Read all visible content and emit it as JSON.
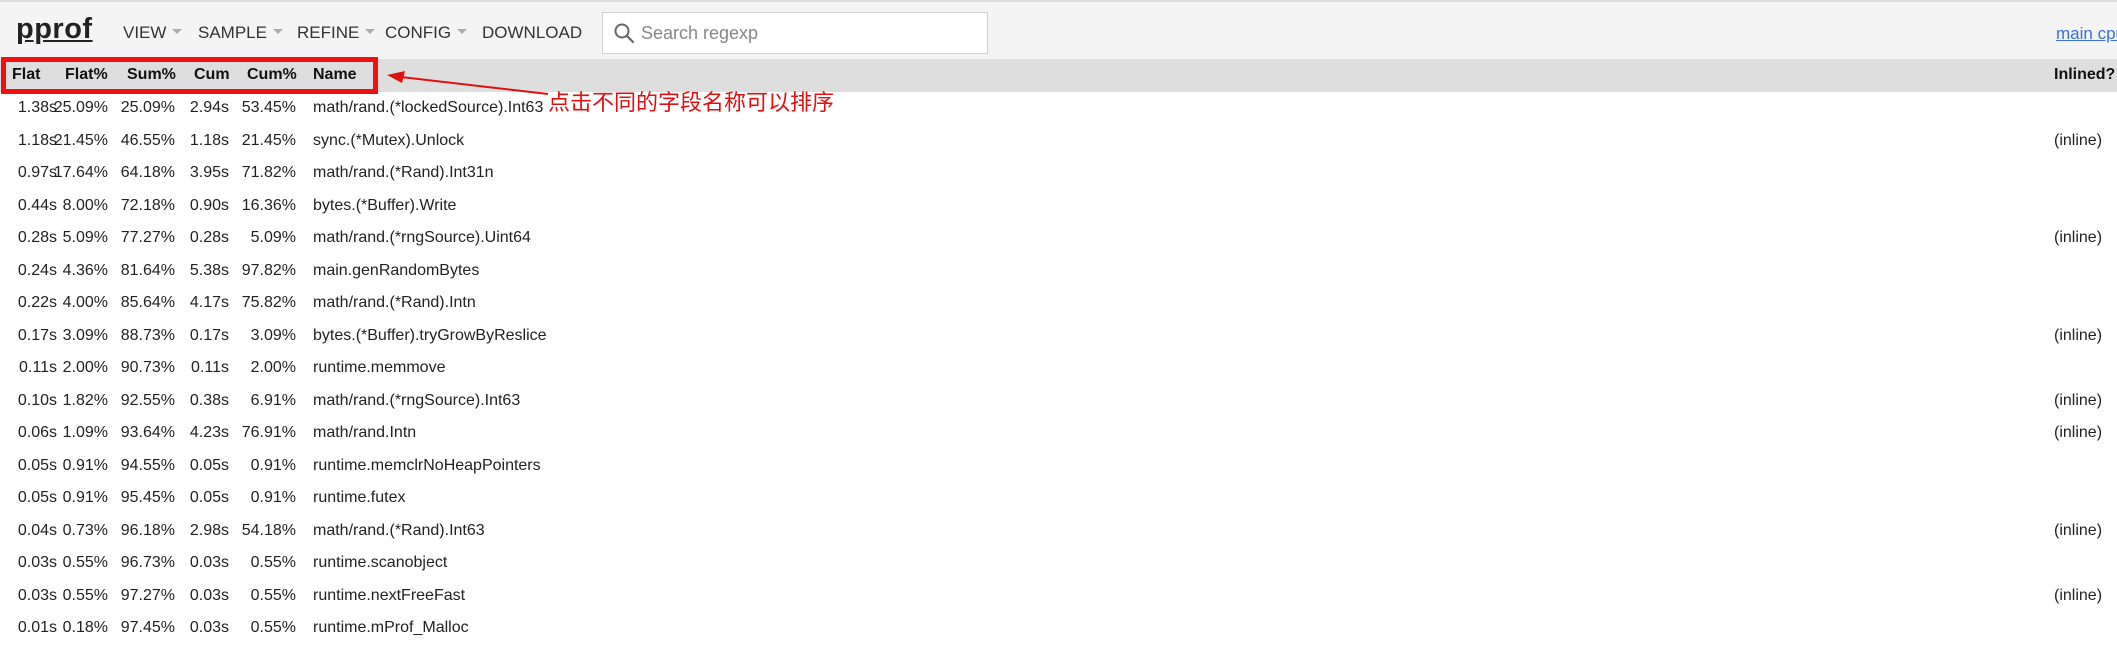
{
  "header": {
    "title": "pprof",
    "menu": [
      "VIEW",
      "SAMPLE",
      "REFINE",
      "CONFIG",
      "DOWNLOAD"
    ],
    "search_placeholder": "Search regexp",
    "profile_link": "main cpu"
  },
  "table": {
    "columns": [
      "Flat",
      "Flat%",
      "Sum%",
      "Cum",
      "Cum%",
      "Name"
    ],
    "inlined_header": "Inlined?",
    "rows": [
      [
        "1.38s",
        "25.09%",
        "25.09%",
        "2.94s",
        "53.45%",
        "math/rand.(*lockedSource).Int63",
        ""
      ],
      [
        "1.18s",
        "21.45%",
        "46.55%",
        "1.18s",
        "21.45%",
        "sync.(*Mutex).Unlock",
        "(inline)"
      ],
      [
        "0.97s",
        "17.64%",
        "64.18%",
        "3.95s",
        "71.82%",
        "math/rand.(*Rand).Int31n",
        ""
      ],
      [
        "0.44s",
        "8.00%",
        "72.18%",
        "0.90s",
        "16.36%",
        "bytes.(*Buffer).Write",
        ""
      ],
      [
        "0.28s",
        "5.09%",
        "77.27%",
        "0.28s",
        "5.09%",
        "math/rand.(*rngSource).Uint64",
        "(inline)"
      ],
      [
        "0.24s",
        "4.36%",
        "81.64%",
        "5.38s",
        "97.82%",
        "main.genRandomBytes",
        ""
      ],
      [
        "0.22s",
        "4.00%",
        "85.64%",
        "4.17s",
        "75.82%",
        "math/rand.(*Rand).Intn",
        ""
      ],
      [
        "0.17s",
        "3.09%",
        "88.73%",
        "0.17s",
        "3.09%",
        "bytes.(*Buffer).tryGrowByReslice",
        "(inline)"
      ],
      [
        "0.11s",
        "2.00%",
        "90.73%",
        "0.11s",
        "2.00%",
        "runtime.memmove",
        ""
      ],
      [
        "0.10s",
        "1.82%",
        "92.55%",
        "0.38s",
        "6.91%",
        "math/rand.(*rngSource).Int63",
        "(inline)"
      ],
      [
        "0.06s",
        "1.09%",
        "93.64%",
        "4.23s",
        "76.91%",
        "math/rand.Intn",
        "(inline)"
      ],
      [
        "0.05s",
        "0.91%",
        "94.55%",
        "0.05s",
        "0.91%",
        "runtime.memclrNoHeapPointers",
        ""
      ],
      [
        "0.05s",
        "0.91%",
        "95.45%",
        "0.05s",
        "0.91%",
        "runtime.futex",
        ""
      ],
      [
        "0.04s",
        "0.73%",
        "96.18%",
        "2.98s",
        "54.18%",
        "math/rand.(*Rand).Int63",
        "(inline)"
      ],
      [
        "0.03s",
        "0.55%",
        "96.73%",
        "0.03s",
        "0.55%",
        "runtime.scanobject",
        ""
      ],
      [
        "0.03s",
        "0.55%",
        "97.27%",
        "0.03s",
        "0.55%",
        "runtime.nextFreeFast",
        "(inline)"
      ],
      [
        "0.01s",
        "0.18%",
        "97.45%",
        "0.03s",
        "0.55%",
        "runtime.mProf_Malloc",
        ""
      ]
    ]
  },
  "annotation": {
    "text": "点击不同的字段名称可以排序",
    "color": "#e01010"
  },
  "colors": {
    "header_bg": "#f4f4f4",
    "table_header_bg": "#dedede",
    "highlight": "#ee1111",
    "link": "#3a6fd8"
  }
}
